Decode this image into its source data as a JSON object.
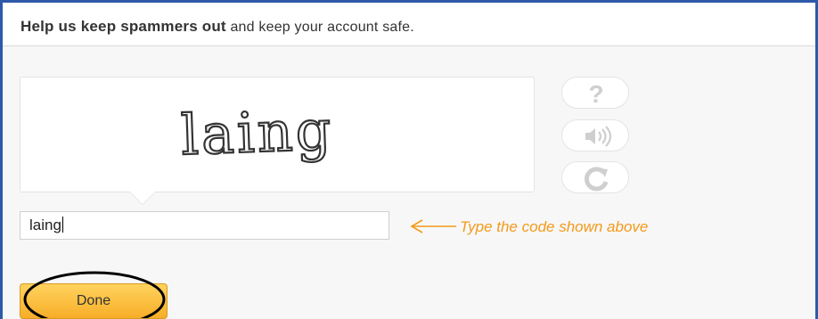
{
  "header": {
    "title_bold": "Help us keep spammers out",
    "title_rest": " and keep your account safe."
  },
  "captcha": {
    "image_text": "laing",
    "buttons": [
      {
        "name": "help",
        "icon": "question-mark-icon"
      },
      {
        "name": "audio",
        "icon": "speaker-icon"
      },
      {
        "name": "refresh",
        "icon": "refresh-icon"
      }
    ],
    "input_value": "laing",
    "hint": "Type the code shown above"
  },
  "actions": {
    "done_label": "Done"
  },
  "colors": {
    "frame_border": "#2c5aa8",
    "hint": "#f39a1a",
    "done_button": "#f7ae27",
    "icon_gray": "#cfcfcf"
  }
}
